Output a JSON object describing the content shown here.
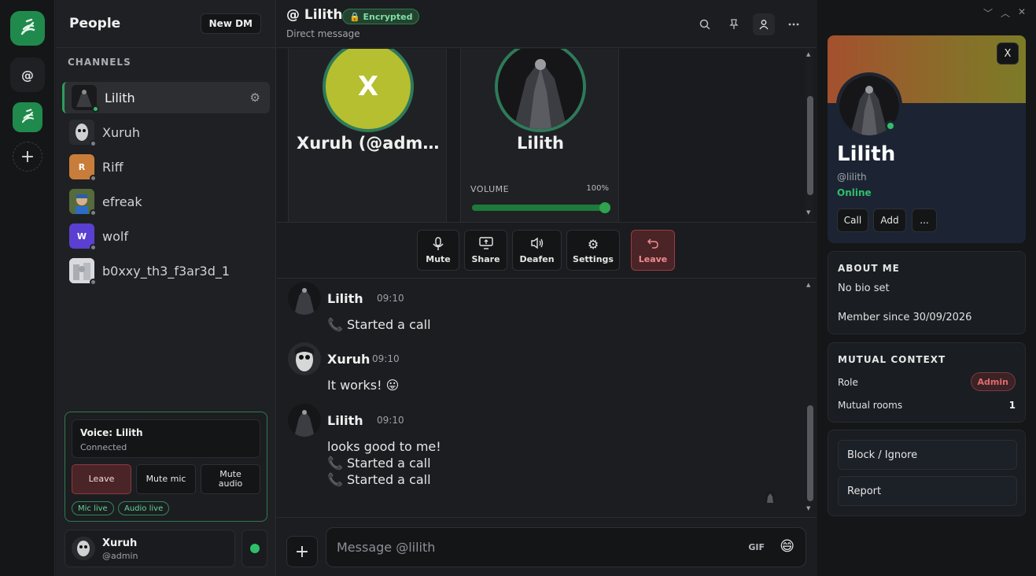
{
  "rail": {
    "dm_label": "@",
    "add_label": "+"
  },
  "people": {
    "title": "People",
    "new_dm": "New DM",
    "section": "CHANNELS",
    "items": [
      {
        "name": "Lilith",
        "letter": "",
        "status": "online"
      },
      {
        "name": "Xuruh",
        "letter": "",
        "status": "offline"
      },
      {
        "name": "Riff",
        "letter": "R",
        "status": "offline"
      },
      {
        "name": "efreak",
        "letter": "",
        "status": "offline"
      },
      {
        "name": "wolf",
        "letter": "W",
        "status": "offline"
      },
      {
        "name": "b0xxy_th3_f3ar3d_1",
        "letter": "",
        "status": "offline"
      }
    ]
  },
  "voice": {
    "title": "Voice: Lilith",
    "status": "Connected",
    "leave": "Leave",
    "mute_mic": "Mute mic",
    "mute_audio": "Mute audio",
    "pills": [
      "Mic live",
      "Audio live"
    ]
  },
  "current_user": {
    "name": "Xuruh",
    "handle": "@admin"
  },
  "header": {
    "title": "@ Lilith",
    "badge": "🔒 Encrypted",
    "subtitle": "Direct message"
  },
  "call": {
    "tiles": [
      {
        "name": "Xuruh (@admi...",
        "letter": "X"
      },
      {
        "name": "Lilith",
        "letter": ""
      }
    ],
    "volume_label": "VOLUME",
    "volume_value": "100%",
    "volume_level": 1.0,
    "controls": [
      "Mute",
      "Share",
      "Deafen",
      "Settings",
      "Leave"
    ]
  },
  "messages": [
    {
      "author": "Lilith",
      "time": "09:10",
      "lines": [
        "📞 Started a call"
      ]
    },
    {
      "author": "Xuruh",
      "time": "09:10",
      "lines": [
        "It works! 😛"
      ]
    },
    {
      "author": "Lilith",
      "time": "09:10",
      "lines": [
        "looks good to me!",
        "📞 Started a call",
        "📞 Started a call"
      ]
    }
  ],
  "composer": {
    "placeholder": "Message @lilith",
    "gif": "GIF",
    "emoji": "😄",
    "plus": "+"
  },
  "profile": {
    "close": "X",
    "name": "Lilith",
    "handle": "@lilith",
    "status": "Online",
    "buttons": [
      "Call",
      "Add",
      "..."
    ],
    "about_title": "ABOUT ME",
    "bio": "No bio set",
    "member_since": "Member since 30/09/2026",
    "mutual_title": "MUTUAL CONTEXT",
    "role_label": "Role",
    "role_value": "Admin",
    "rooms_label": "Mutual rooms",
    "rooms_value": "1",
    "block": "Block / Ignore",
    "report": "Report"
  },
  "colors": {
    "accent": "#2fbf6a",
    "danger": "#e06b72",
    "brand": "#1f8a4c"
  }
}
